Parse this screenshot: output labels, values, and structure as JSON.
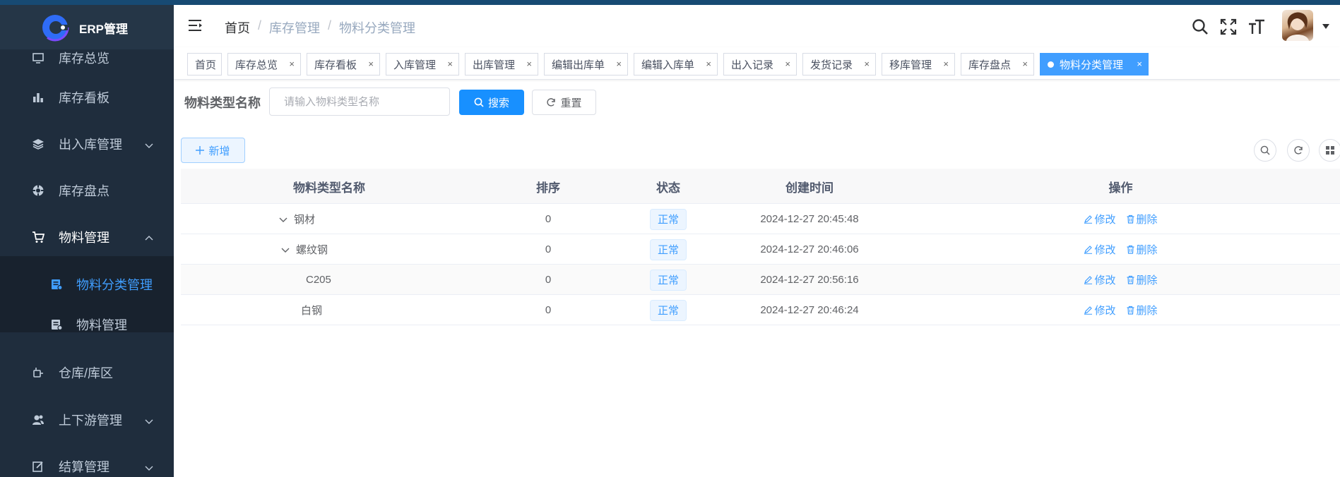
{
  "app": {
    "title": "ERP管理"
  },
  "sidebar": {
    "items": [
      {
        "label": "库存总览",
        "icon": "monitor-icon"
      },
      {
        "label": "库存看板",
        "icon": "bar-chart-icon"
      },
      {
        "label": "出入库管理",
        "icon": "layers-icon"
      },
      {
        "label": "库存盘点",
        "icon": "target-icon"
      },
      {
        "label": "物料管理",
        "icon": "cart-icon"
      },
      {
        "label": "物料分类管理",
        "icon": "doc-icon"
      },
      {
        "label": "物料管理",
        "icon": "doc-icon"
      },
      {
        "label": "仓库/库区",
        "icon": "plug-icon"
      },
      {
        "label": "上下游管理",
        "icon": "users-icon"
      },
      {
        "label": "结算管理",
        "icon": "edit-icon"
      }
    ]
  },
  "breadcrumb": [
    "首页",
    "库存管理",
    "物料分类管理"
  ],
  "tags": [
    {
      "label": "首页"
    },
    {
      "label": "库存总览"
    },
    {
      "label": "库存看板"
    },
    {
      "label": "入库管理"
    },
    {
      "label": "出库管理"
    },
    {
      "label": "编辑出库单"
    },
    {
      "label": "编辑入库单"
    },
    {
      "label": "出入记录"
    },
    {
      "label": "发货记录"
    },
    {
      "label": "移库管理"
    },
    {
      "label": "库存盘点"
    },
    {
      "label": "物料分类管理"
    }
  ],
  "tag_close": "×",
  "search": {
    "label": "物料类型名称",
    "placeholder": "请输入物料类型名称",
    "search_button": "搜索",
    "reset_button": "重置"
  },
  "toolbar": {
    "add_button": "新增"
  },
  "table": {
    "headers": [
      "物料类型名称",
      "排序",
      "状态",
      "创建时间",
      "操作"
    ],
    "rows": [
      {
        "name": "钢材",
        "sort": "0",
        "status": "正常",
        "created": "2024-12-27 20:45:48"
      },
      {
        "name": "螺纹钢",
        "sort": "0",
        "status": "正常",
        "created": "2024-12-27 20:46:06"
      },
      {
        "name": "C205",
        "sort": "0",
        "status": "正常",
        "created": "2024-12-27 20:56:16"
      },
      {
        "name": "白钢",
        "sort": "0",
        "status": "正常",
        "created": "2024-12-27 20:46:24"
      }
    ],
    "edit_label": "修改",
    "delete_label": "删除"
  },
  "colors": {
    "sidebar_bg": "#1f2d3d",
    "accent": "#409eff",
    "primary_button": "#1890ff"
  }
}
